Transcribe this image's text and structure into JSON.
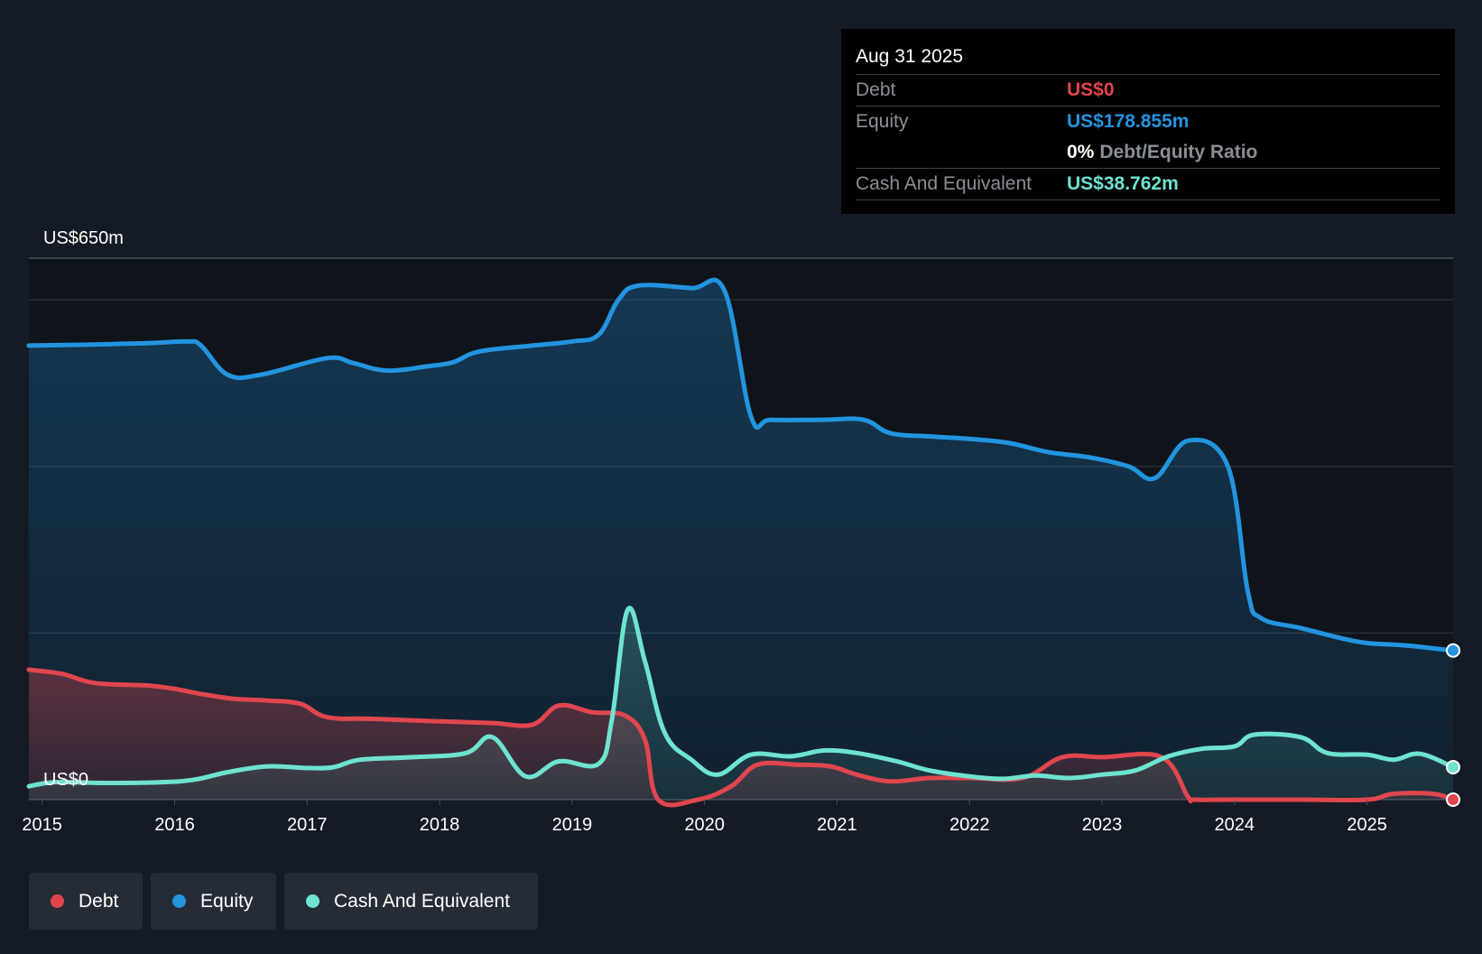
{
  "chart_data": {
    "type": "area",
    "y_top_label": "US$650m",
    "y_zero_label": "US$0",
    "ylim": [
      0,
      650
    ],
    "xlim": [
      2014.9,
      2025.65
    ],
    "x_ticks": [
      "2015",
      "2016",
      "2017",
      "2018",
      "2019",
      "2020",
      "2021",
      "2022",
      "2023",
      "2024",
      "2025"
    ],
    "grid": true,
    "colors": {
      "debt": "#e0464e",
      "equity": "#2394df",
      "cash": "#6ee3d0",
      "background": "#151b24",
      "plot_background": "#0f141b"
    },
    "series": [
      {
        "name": "Debt",
        "color": "#e0464e",
        "points": [
          [
            2014.9,
            156
          ],
          [
            2015.15,
            151
          ],
          [
            2015.4,
            140
          ],
          [
            2015.8,
            137
          ],
          [
            2016.0,
            133
          ],
          [
            2016.2,
            127
          ],
          [
            2016.45,
            121
          ],
          [
            2016.7,
            119
          ],
          [
            2016.95,
            115
          ],
          [
            2017.15,
            99
          ],
          [
            2017.5,
            97
          ],
          [
            2018.0,
            94
          ],
          [
            2018.4,
            92
          ],
          [
            2018.7,
            90
          ],
          [
            2018.9,
            113
          ],
          [
            2019.15,
            105
          ],
          [
            2019.4,
            101
          ],
          [
            2019.55,
            72
          ],
          [
            2019.65,
            0
          ],
          [
            2019.95,
            0
          ],
          [
            2020.2,
            16
          ],
          [
            2020.4,
            42
          ],
          [
            2020.7,
            42
          ],
          [
            2020.95,
            40
          ],
          [
            2021.15,
            30
          ],
          [
            2021.4,
            22
          ],
          [
            2021.7,
            26
          ],
          [
            2022.0,
            26
          ],
          [
            2022.4,
            26
          ],
          [
            2022.7,
            51
          ],
          [
            2023.0,
            51
          ],
          [
            2023.45,
            51
          ],
          [
            2023.65,
            3
          ],
          [
            2023.7,
            0
          ],
          [
            2024.0,
            0
          ],
          [
            2024.5,
            0
          ],
          [
            2025.0,
            0
          ],
          [
            2025.2,
            7
          ],
          [
            2025.5,
            7
          ],
          [
            2025.65,
            0
          ]
        ]
      },
      {
        "name": "Equity",
        "color": "#2394df",
        "points": [
          [
            2014.9,
            545
          ],
          [
            2015.3,
            546
          ],
          [
            2015.8,
            548
          ],
          [
            2016.1,
            550
          ],
          [
            2016.2,
            545
          ],
          [
            2016.4,
            510
          ],
          [
            2016.65,
            510
          ],
          [
            2017.15,
            530
          ],
          [
            2017.35,
            524
          ],
          [
            2017.6,
            515
          ],
          [
            2017.9,
            520
          ],
          [
            2018.1,
            525
          ],
          [
            2018.3,
            538
          ],
          [
            2018.7,
            545
          ],
          [
            2019.0,
            550
          ],
          [
            2019.2,
            558
          ],
          [
            2019.35,
            600
          ],
          [
            2019.5,
            617
          ],
          [
            2019.9,
            614
          ],
          [
            2020.15,
            611
          ],
          [
            2020.35,
            460
          ],
          [
            2020.5,
            456
          ],
          [
            2020.9,
            456
          ],
          [
            2021.2,
            456
          ],
          [
            2021.4,
            440
          ],
          [
            2021.7,
            436
          ],
          [
            2022.0,
            433
          ],
          [
            2022.3,
            428
          ],
          [
            2022.6,
            417
          ],
          [
            2022.9,
            411
          ],
          [
            2023.2,
            400
          ],
          [
            2023.4,
            386
          ],
          [
            2023.65,
            431
          ],
          [
            2023.95,
            400
          ],
          [
            2024.1,
            250
          ],
          [
            2024.2,
            218
          ],
          [
            2024.5,
            206
          ],
          [
            2024.8,
            194
          ],
          [
            2025.0,
            188
          ],
          [
            2025.3,
            185
          ],
          [
            2025.65,
            179
          ]
        ]
      },
      {
        "name": "Cash And Equivalent",
        "color": "#6ee3d0",
        "points": [
          [
            2014.9,
            16
          ],
          [
            2015.1,
            21
          ],
          [
            2015.5,
            20
          ],
          [
            2015.9,
            21
          ],
          [
            2016.15,
            24
          ],
          [
            2016.4,
            33
          ],
          [
            2016.7,
            40
          ],
          [
            2017.0,
            38
          ],
          [
            2017.2,
            39
          ],
          [
            2017.4,
            48
          ],
          [
            2017.8,
            51
          ],
          [
            2018.2,
            56
          ],
          [
            2018.4,
            75
          ],
          [
            2018.65,
            28
          ],
          [
            2018.9,
            46
          ],
          [
            2019.2,
            43
          ],
          [
            2019.3,
            96
          ],
          [
            2019.42,
            228
          ],
          [
            2019.55,
            166
          ],
          [
            2019.7,
            80
          ],
          [
            2019.9,
            48
          ],
          [
            2020.1,
            30
          ],
          [
            2020.35,
            54
          ],
          [
            2020.65,
            52
          ],
          [
            2020.9,
            59
          ],
          [
            2021.15,
            56
          ],
          [
            2021.45,
            46
          ],
          [
            2021.7,
            35
          ],
          [
            2022.0,
            28
          ],
          [
            2022.25,
            25
          ],
          [
            2022.5,
            29
          ],
          [
            2022.75,
            26
          ],
          [
            2023.0,
            30
          ],
          [
            2023.25,
            35
          ],
          [
            2023.5,
            52
          ],
          [
            2023.75,
            61
          ],
          [
            2024.0,
            64
          ],
          [
            2024.15,
            78
          ],
          [
            2024.5,
            75
          ],
          [
            2024.7,
            56
          ],
          [
            2025.0,
            54
          ],
          [
            2025.2,
            48
          ],
          [
            2025.4,
            55
          ],
          [
            2025.65,
            39
          ]
        ]
      }
    ],
    "legend": [
      {
        "name": "Debt",
        "color": "#e0464e"
      },
      {
        "name": "Equity",
        "color": "#2394df"
      },
      {
        "name": "Cash And Equivalent",
        "color": "#6ee3d0"
      }
    ]
  },
  "tooltip": {
    "date": "Aug 31 2025",
    "debt_label": "Debt",
    "debt_value": "US$0",
    "equity_label": "Equity",
    "equity_value": "US$178.855m",
    "ratio_value": "0%",
    "ratio_label": "Debt/Equity Ratio",
    "cash_label": "Cash And Equivalent",
    "cash_value": "US$38.762m"
  }
}
